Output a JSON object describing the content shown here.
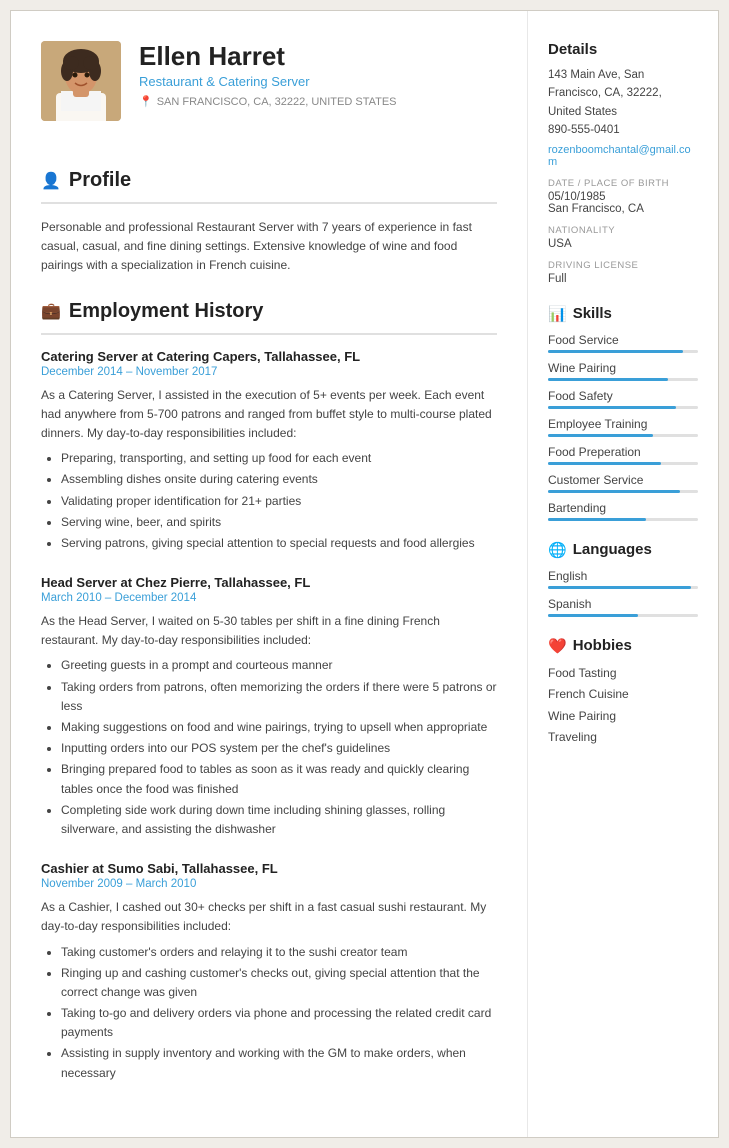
{
  "header": {
    "name": "Ellen Harret",
    "title": "Restaurant & Catering Server",
    "location": "SAN FRANCISCO, CA, 32222, UNITED STATES"
  },
  "profile": {
    "section_title": "Profile",
    "text": "Personable and professional Restaurant Server with 7 years of experience in fast casual, casual, and fine dining settings. Extensive knowledge of wine and food pairings with a specialization in French cuisine."
  },
  "employment": {
    "section_title": "Employment History",
    "jobs": [
      {
        "title": "Catering Server at Catering Capers, Tallahassee, FL",
        "dates": "December 2014  –  November 2017",
        "desc": "As a Catering Server, I assisted in the execution of 5+ events per week. Each event had anywhere from 5-700 patrons and ranged from buffet style to multi-course plated dinners. My day-to-day responsibilities included:",
        "bullets": [
          "Preparing, transporting, and setting up food for each event",
          "Assembling dishes onsite during catering events",
          "Validating proper identification for 21+ parties",
          "Serving wine, beer, and spirits",
          "Serving patrons, giving special attention to special requests and food allergies"
        ]
      },
      {
        "title": "Head Server at Chez Pierre, Tallahassee, FL",
        "dates": "March 2010  –  December 2014",
        "desc": "As the Head Server, I waited on 5-30 tables per shift in a fine dining French restaurant. My day-to-day responsibilities included:",
        "bullets": [
          "Greeting guests in a prompt and courteous manner",
          "Taking orders from patrons, often memorizing the orders if there were 5 patrons or less",
          "Making suggestions on food and wine pairings, trying to upsell when appropriate",
          "Inputting orders into our POS system per the chef's guidelines",
          "Bringing prepared food to tables as soon as it was ready and quickly clearing tables once the food was finished",
          "Completing side work during down time including shining glasses, rolling silverware, and assisting the dishwasher"
        ]
      },
      {
        "title": "Cashier at Sumo Sabi, Tallahassee, FL",
        "dates": "November 2009  –  March 2010",
        "desc": "As a Cashier, I cashed out 30+ checks per shift in a fast casual sushi restaurant. My day-to-day responsibilities included:",
        "bullets": [
          "Taking customer's orders and relaying it to the sushi creator team",
          "Ringing up and cashing customer's checks out, giving special attention that the correct change was given",
          "Taking to-go and delivery orders via phone and processing the related credit card payments",
          "Assisting in supply inventory and working with the GM to make orders, when necessary"
        ]
      }
    ]
  },
  "details": {
    "section_title": "Details",
    "address": "143 Main Ave, San Francisco, CA, 32222, United States",
    "phone": "890-555-0401",
    "email": "rozenboomchantal@gmail.com",
    "dob_label": "DATE / PLACE OF BIRTH",
    "dob": "05/10/1985",
    "dob_place": "San Francisco, CA",
    "nationality_label": "NATIONALITY",
    "nationality": "USA",
    "license_label": "DRIVING LICENSE",
    "license": "Full"
  },
  "skills": {
    "section_title": "Skills",
    "items": [
      {
        "name": "Food Service",
        "level": 90
      },
      {
        "name": "Wine Pairing",
        "level": 80
      },
      {
        "name": "Food Safety",
        "level": 85
      },
      {
        "name": "Employee Training",
        "level": 70
      },
      {
        "name": "Food Preperation",
        "level": 75
      },
      {
        "name": "Customer Service",
        "level": 88
      },
      {
        "name": "Bartending",
        "level": 65
      }
    ]
  },
  "languages": {
    "section_title": "Languages",
    "items": [
      {
        "name": "English",
        "level": 95
      },
      {
        "name": "Spanish",
        "level": 60
      }
    ]
  },
  "hobbies": {
    "section_title": "Hobbies",
    "items": [
      "Food Tasting",
      "French Cuisine",
      "Wine Pairing",
      "Traveling"
    ]
  }
}
